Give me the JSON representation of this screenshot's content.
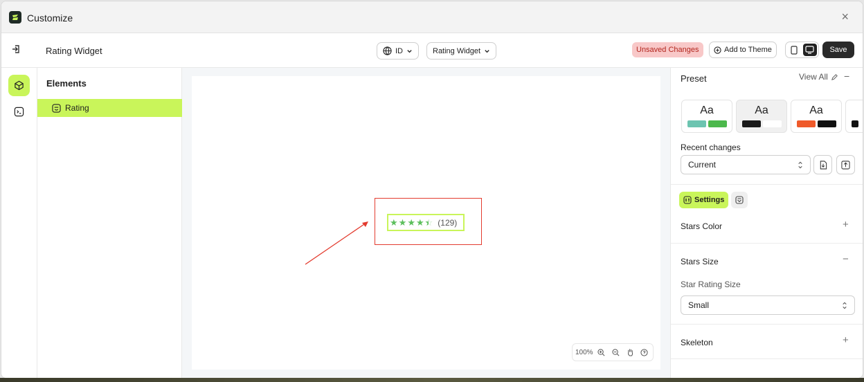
{
  "window": {
    "title": "Customize",
    "close_glyph": "×"
  },
  "toolbar": {
    "page_name": "Rating Widget",
    "language": "ID",
    "template": "Rating Widget",
    "unsaved": "Unsaved Changes",
    "add_to_theme": "Add to Theme",
    "save": "Save"
  },
  "elements_panel": {
    "title": "Elements",
    "items": [
      {
        "label": "Rating",
        "icon": "rating-element-icon"
      }
    ]
  },
  "canvas": {
    "rating": {
      "stars": 4.5,
      "max_stars": 5,
      "count_label": "(129)",
      "star_color": "#5cbf5c"
    },
    "zoom": "100%"
  },
  "right_panel": {
    "preset": {
      "title": "Preset",
      "view_all": "View All",
      "cards": [
        {
          "label": "Aa",
          "swatches": [
            "#6cc4b0",
            "#4cb84c"
          ]
        },
        {
          "label": "Aa",
          "swatches": [
            "#1a1a1a",
            "#ffffff"
          ]
        },
        {
          "label": "Aa",
          "swatches": [
            "#ef5a2a",
            "#111111"
          ]
        },
        {
          "label": "",
          "swatches": [
            "#111111"
          ]
        }
      ]
    },
    "recent_changes": {
      "label": "Recent changes",
      "value": "Current"
    },
    "tabs": {
      "settings": "Settings"
    },
    "sections": {
      "stars_color": "Stars Color",
      "stars_size": "Stars Size",
      "star_rating_size_label": "Star Rating Size",
      "star_rating_size_value": "Small",
      "skeleton": "Skeleton"
    },
    "toggles": {
      "plus": "+",
      "minus": "−"
    }
  },
  "colors": {
    "accent": "#c9f55a",
    "danger": "#e33b2e"
  }
}
